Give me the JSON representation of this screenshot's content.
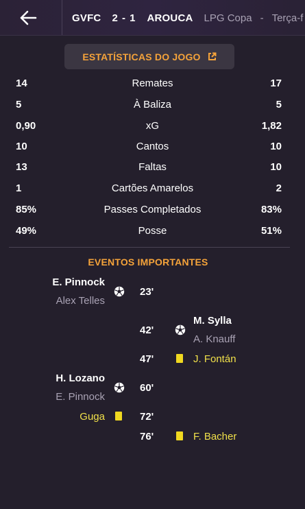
{
  "header": {
    "home_team": "GVFC",
    "score": "2 - 1",
    "away_team": "AROUCA",
    "competition": "LPG Copa",
    "separator": "-",
    "date": "Terça-f"
  },
  "stats_button": {
    "label": "ESTATÍSTICAS DO JOGO"
  },
  "stats": [
    {
      "label": "Remates",
      "home": "14",
      "away": "17"
    },
    {
      "label": "À Baliza",
      "home": "5",
      "away": "5"
    },
    {
      "label": "xG",
      "home": "0,90",
      "away": "1,82"
    },
    {
      "label": "Cantos",
      "home": "10",
      "away": "10"
    },
    {
      "label": "Faltas",
      "home": "13",
      "away": "10"
    },
    {
      "label": "Cartões Amarelos",
      "home": "1",
      "away": "2"
    },
    {
      "label": "Passes Completados",
      "home": "85%",
      "away": "83%"
    },
    {
      "label": "Posse",
      "home": "49%",
      "away": "51%"
    }
  ],
  "events": {
    "title": "EVENTOS IMPORTANTES",
    "items": [
      {
        "side": "home",
        "type": "goal",
        "minute": "23'",
        "player": "E. Pinnock",
        "assist": "Alex Telles"
      },
      {
        "side": "away",
        "type": "goal",
        "minute": "42'",
        "player": "M. Sylla",
        "assist": "A. Knauff"
      },
      {
        "side": "away",
        "type": "yellow-card",
        "minute": "47'",
        "player": "J. Fontán"
      },
      {
        "side": "home",
        "type": "goal",
        "minute": "60'",
        "player": "H. Lozano",
        "assist": "E. Pinnock"
      },
      {
        "side": "home",
        "type": "yellow-card",
        "minute": "72'",
        "player": "Guga"
      },
      {
        "side": "away",
        "type": "yellow-card",
        "minute": "76'",
        "player": "F. Bacher"
      }
    ]
  },
  "colors": {
    "accent": "#f5a33a",
    "background": "#241f2c",
    "yellow_card": "#f0d820",
    "muted_text": "#a9a2b4"
  }
}
